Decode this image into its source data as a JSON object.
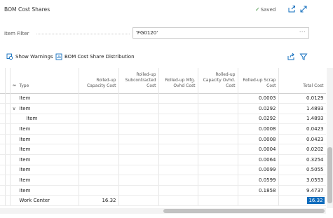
{
  "header": {
    "title": "BOM Cost Shares",
    "saved_label": "Saved"
  },
  "filter": {
    "label": "Item Filter",
    "value": "'FG0120'"
  },
  "toolbar": {
    "show_warnings": "Show Warnings",
    "distribution": "BOM Cost Share Distribution"
  },
  "grid": {
    "columns": {
      "type": "Type",
      "capacity": "Rolled-up Capacity Cost",
      "subcontracted": "Rolled-up Subcontracted Cost",
      "mfg_ovhd": "Rolled-up Mfg. Ovhd Cost",
      "cap_ovhd": "Rolled-up Capacity Ovhd. Cost",
      "scrap": "Rolled-up Scrap Cost",
      "total": "Total Cost"
    },
    "rows": [
      {
        "type": "Item",
        "indent": 0,
        "expander": "",
        "capacity": "",
        "scrap": "0.0003",
        "total": "0.0129"
      },
      {
        "type": "Item",
        "indent": 0,
        "expander": "∨",
        "capacity": "",
        "scrap": "0.0292",
        "total": "1.4893"
      },
      {
        "type": "Item",
        "indent": 1,
        "expander": "",
        "capacity": "",
        "scrap": "0.0292",
        "total": "1.4893"
      },
      {
        "type": "Item",
        "indent": 0,
        "expander": "",
        "capacity": "",
        "scrap": "0.0008",
        "total": "0.0423"
      },
      {
        "type": "Item",
        "indent": 0,
        "expander": "",
        "capacity": "",
        "scrap": "0.0008",
        "total": "0.0423"
      },
      {
        "type": "Item",
        "indent": 0,
        "expander": "",
        "capacity": "",
        "scrap": "0.0004",
        "total": "0.0202"
      },
      {
        "type": "Item",
        "indent": 0,
        "expander": "",
        "capacity": "",
        "scrap": "0.0064",
        "total": "0.3254"
      },
      {
        "type": "Item",
        "indent": 0,
        "expander": "",
        "capacity": "",
        "scrap": "0.0099",
        "total": "0.5055"
      },
      {
        "type": "Item",
        "indent": 0,
        "expander": "",
        "capacity": "",
        "scrap": "0.0599",
        "total": "3.0553"
      },
      {
        "type": "Item",
        "indent": 0,
        "expander": "",
        "capacity": "",
        "scrap": "0.1858",
        "total": "9.4737"
      },
      {
        "type": "Work Center",
        "indent": 0,
        "expander": "",
        "capacity": "16.32",
        "scrap": "",
        "total": "16.32",
        "selected": true
      }
    ]
  },
  "icons": [
    "checkmark-icon",
    "share-icon",
    "expand-icon",
    "ellipsis-icon",
    "warning-icon",
    "distribution-icon",
    "filter-icon"
  ]
}
